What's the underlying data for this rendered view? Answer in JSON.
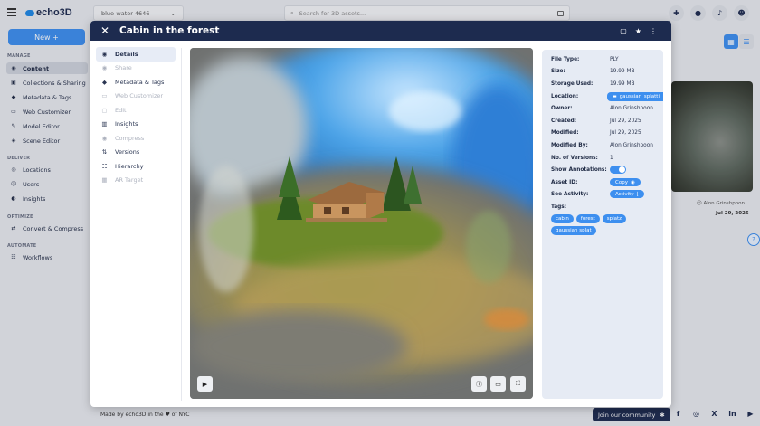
{
  "app": {
    "logo_text": "echo3D",
    "project": "blue-water-4646",
    "search_placeholder": "Search for 3D assets...",
    "new_button": "New +"
  },
  "sidebar": {
    "manage_label": "MANAGE",
    "deliver_label": "DELIVER",
    "optimize_label": "OPTIMIZE",
    "automate_label": "AUTOMATE",
    "items": [
      {
        "label": "Content",
        "icon": "cube-icon"
      },
      {
        "label": "Collections & Sharing",
        "icon": "collections-icon"
      },
      {
        "label": "Metadata & Tags",
        "icon": "tag-icon"
      },
      {
        "label": "Web Customizer",
        "icon": "web-icon"
      },
      {
        "label": "Model Editor",
        "icon": "pencil-icon"
      },
      {
        "label": "Scene Editor",
        "icon": "scene-icon"
      },
      {
        "label": "Locations",
        "icon": "location-icon"
      },
      {
        "label": "Users",
        "icon": "user-icon"
      },
      {
        "label": "Insights",
        "icon": "insights-icon"
      },
      {
        "label": "Convert & Compress",
        "icon": "convert-icon"
      },
      {
        "label": "Workflows",
        "icon": "workflow-icon"
      }
    ]
  },
  "background_card": {
    "owner": "Alon Grinshpoon",
    "date": "Jul 29, 2025"
  },
  "modal": {
    "title": "Cabin in the forest",
    "tabs": [
      {
        "label": "Details",
        "icon": "info-icon",
        "state": "active"
      },
      {
        "label": "Share",
        "icon": "share-icon",
        "state": "disabled"
      },
      {
        "label": "Metadata & Tags",
        "icon": "tag-icon",
        "state": "normal"
      },
      {
        "label": "Web Customizer",
        "icon": "web-icon",
        "state": "disabled"
      },
      {
        "label": "Edit",
        "icon": "pencil-icon",
        "state": "disabled"
      },
      {
        "label": "Insights",
        "icon": "insights-icon",
        "state": "normal"
      },
      {
        "label": "Compress",
        "icon": "compress-icon",
        "state": "disabled"
      },
      {
        "label": "Versions",
        "icon": "versions-icon",
        "state": "normal"
      },
      {
        "label": "Hierarchy",
        "icon": "hierarchy-icon",
        "state": "normal"
      },
      {
        "label": "AR Target",
        "icon": "ar-target-icon",
        "state": "disabled"
      }
    ],
    "details": {
      "file_type_label": "File Type:",
      "file_type": "PLY",
      "size_label": "Size:",
      "size": "19.99 MB",
      "storage_label": "Storage Used:",
      "storage": "19.99 MB",
      "location_label": "Location:",
      "location": "gaussian_splatti",
      "owner_label": "Owner:",
      "owner": "Alon Grinshpoon",
      "created_label": "Created:",
      "created": "Jul 29, 2025",
      "modified_label": "Modified:",
      "modified": "Jul 29, 2025",
      "modified_by_label": "Modified By:",
      "modified_by": "Alon Grinshpoon",
      "versions_label": "No. of Versions:",
      "versions": "1",
      "annotations_label": "Show Annotations:",
      "annotations_on": true,
      "asset_id_label": "Asset ID:",
      "copy_button": "Copy",
      "activity_label": "See Activity:",
      "activity_button": "Activity",
      "tags_label": "Tags:",
      "tags": [
        "cabin",
        "forest",
        "splatz",
        "gaussian splat"
      ]
    }
  },
  "footer": {
    "made_by": "Made by echo3D in the ♥ of NYC",
    "community": "Join our community"
  },
  "colors": {
    "navy": "#1d2b4f",
    "accent": "#3d8fef",
    "panel": "#e6ebf4"
  }
}
